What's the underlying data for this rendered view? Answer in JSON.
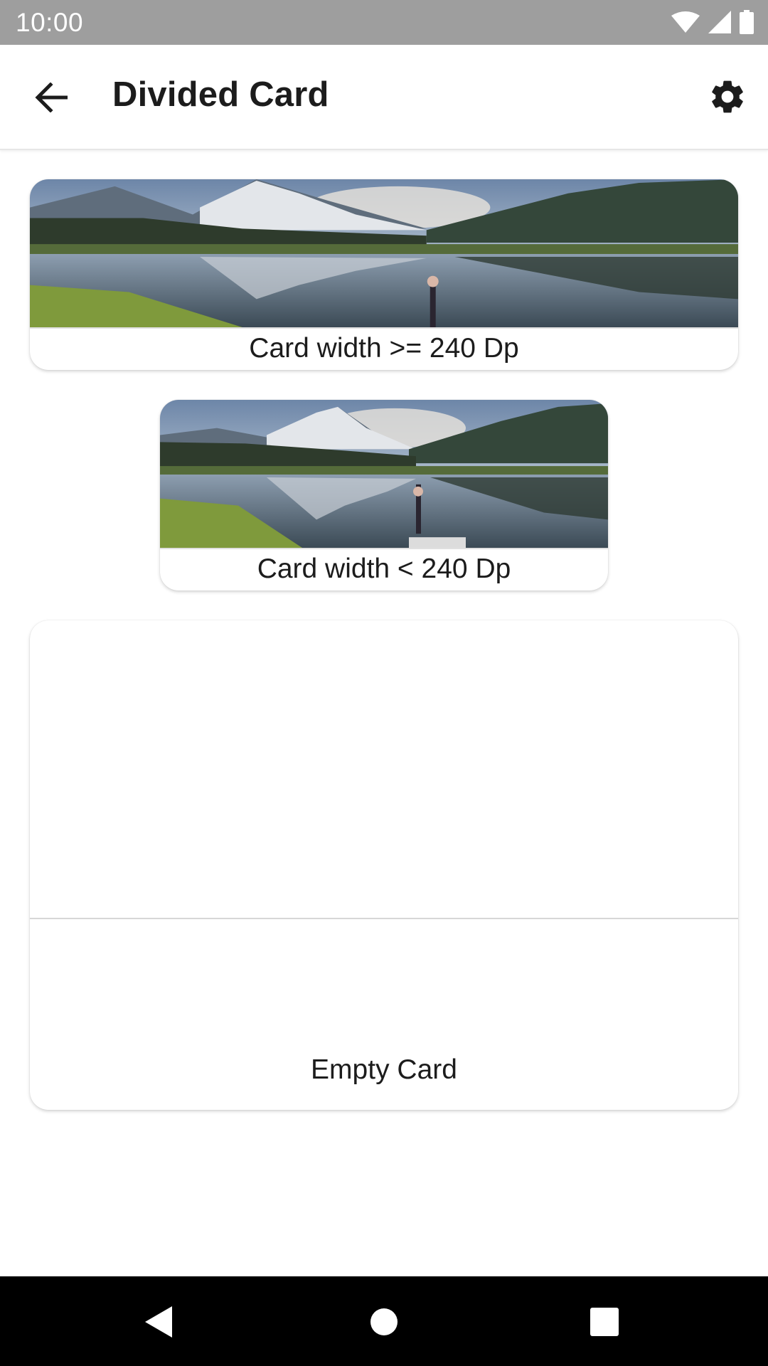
{
  "status_bar": {
    "time": "10:00",
    "icons": [
      "wifi-icon",
      "cellular-signal-icon",
      "battery-icon"
    ]
  },
  "app_bar": {
    "title": "Divided Card",
    "back_icon": "arrow-back-icon",
    "settings_icon": "gear-icon"
  },
  "cards": [
    {
      "caption": "Card width >= 240 Dp",
      "image": "mountain-lake-landscape-photo"
    },
    {
      "caption": "Card width < 240 Dp",
      "image": "mountain-lake-landscape-photo"
    },
    {
      "caption": "Empty Card"
    }
  ],
  "nav_bar": {
    "icons": [
      "nav-back-triangle-icon",
      "nav-home-circle-icon",
      "nav-recents-square-icon"
    ]
  },
  "colors": {
    "status_bar": "#9e9e9e",
    "nav_bar": "#000000",
    "background": "#ffffff",
    "text": "#1c1c1c"
  }
}
